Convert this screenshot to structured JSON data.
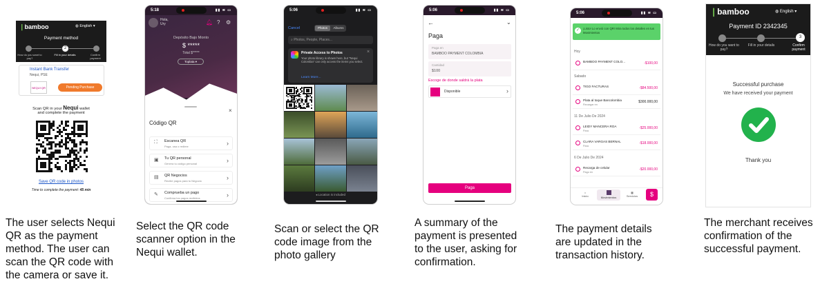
{
  "steps": [
    {
      "caption": "The user selects Nequi QR as the payment method. The user can scan the QR code with the camera or save it."
    },
    {
      "caption": "Select the QR code scanner option in the Nequi wallet."
    },
    {
      "caption": "Scan or select the QR code image from the photo gallery"
    },
    {
      "caption": "A summary of the payment is presented to the user, asking for confirmation."
    },
    {
      "caption": "The payment details are updated in the transaction history."
    },
    {
      "caption": "The merchant receives confirmation of the successful payment."
    }
  ],
  "s1": {
    "brand": "bamboo",
    "lang": "English",
    "title": "Payment method",
    "stepper": [
      "How do you want to pay?",
      "Fill in your details",
      "Confirm payment"
    ],
    "step_num": "2",
    "method_title": "Instant Bank Transfer",
    "method_sub": "Nequi, PSE",
    "logo_text": "NEQUI QR",
    "status": "Pending Purchase",
    "scan_a": "Scan QR in your",
    "scan_brand": "Nequi",
    "scan_b": "wallet",
    "scan_c": "and complete the payment",
    "save_link": "Save QR code in photos",
    "timer_label": "Time to complete the payment:",
    "timer_value": "45 min"
  },
  "s2": {
    "time": "5:18",
    "greet": "Hola,",
    "user": "Ury",
    "deposit_label": "Depósito Bajo Monto",
    "balance": "$ *****",
    "total": "Total $*****",
    "pill": "Toplata",
    "sheet_title": "Código QR",
    "options": [
      {
        "title": "Escanea QR",
        "sub": "Paga, usa o redime"
      },
      {
        "title": "Tu QR personal",
        "sub": "Genera tu código personal"
      },
      {
        "title": "QR Negocios",
        "sub": "Recibe pagos para tu Negocio"
      },
      {
        "title": "Comprueba un pago",
        "sub": "Confirma los pagos recibidos"
      }
    ]
  },
  "s3": {
    "time": "5:06",
    "cancel": "Cancel",
    "tabs": [
      "Photos",
      "Albums"
    ],
    "search": "Photos, People, Places...",
    "notice_title": "Private Access to Photos",
    "notice_body": "Your photo library is shown here, but \"Nequi Colombia\" can only access the items you select.",
    "learn": "Learn More...",
    "footer": "Location is included"
  },
  "s4": {
    "time": "5:06",
    "title": "Paga",
    "field1_label": "Paga en",
    "field1_value": "BAMBOO PAYMENT COLOMBIA",
    "field2_label": "Cantidad",
    "field2_value": "$100",
    "source_label": "Escoge de donde saldrá la plata",
    "source_value": "Disponible",
    "button": "Paga"
  },
  "s5": {
    "time": "5:06",
    "banner": "¡Listo! Lo envió con QR! Mira todos los detalles en tus Movimientos",
    "sections": [
      {
        "label": "Hoy",
        "rows": [
          {
            "name": "BAMBOO PAYMENT COLO...",
            "sub": "",
            "amount": "-$100,00",
            "neg": true
          }
        ]
      },
      {
        "label": "Sabado",
        "rows": [
          {
            "name": "TIGO FACTURAS",
            "sub": "",
            "amount": "-$84.500,00",
            "neg": true
          },
          {
            "name": "Plata al toque Bancolombia",
            "sub": "Recargar en",
            "amount": "$300.000,00",
            "neg": false
          }
        ]
      },
      {
        "label": "11 De Julio De 2024",
        "rows": [
          {
            "name": "LEIDY MANCERA ROA",
            "sub": "Para",
            "amount": "-$25.000,00",
            "neg": true
          },
          {
            "name": "CLARA VARGAS BERNAL",
            "sub": "Para",
            "amount": "-$18.000,00",
            "neg": true
          }
        ]
      },
      {
        "label": "6 De Julio De 2024",
        "rows": [
          {
            "name": "Recarga de celular",
            "sub": "Pago en",
            "amount": "-$20.000,00",
            "neg": true
          }
        ]
      }
    ],
    "nav": [
      "Inicio",
      "Movimientos",
      "Servicios"
    ],
    "fab": "$"
  },
  "s6": {
    "brand": "bamboo",
    "lang": "English",
    "payment_id": "Payment ID 2342345",
    "stepper": [
      "How do you want to pay?",
      "Fill in your details",
      "Confirm payment"
    ],
    "step_num": "3",
    "success": "Successful purchase",
    "received": "We have received your payment",
    "thanks": "Thank you"
  }
}
